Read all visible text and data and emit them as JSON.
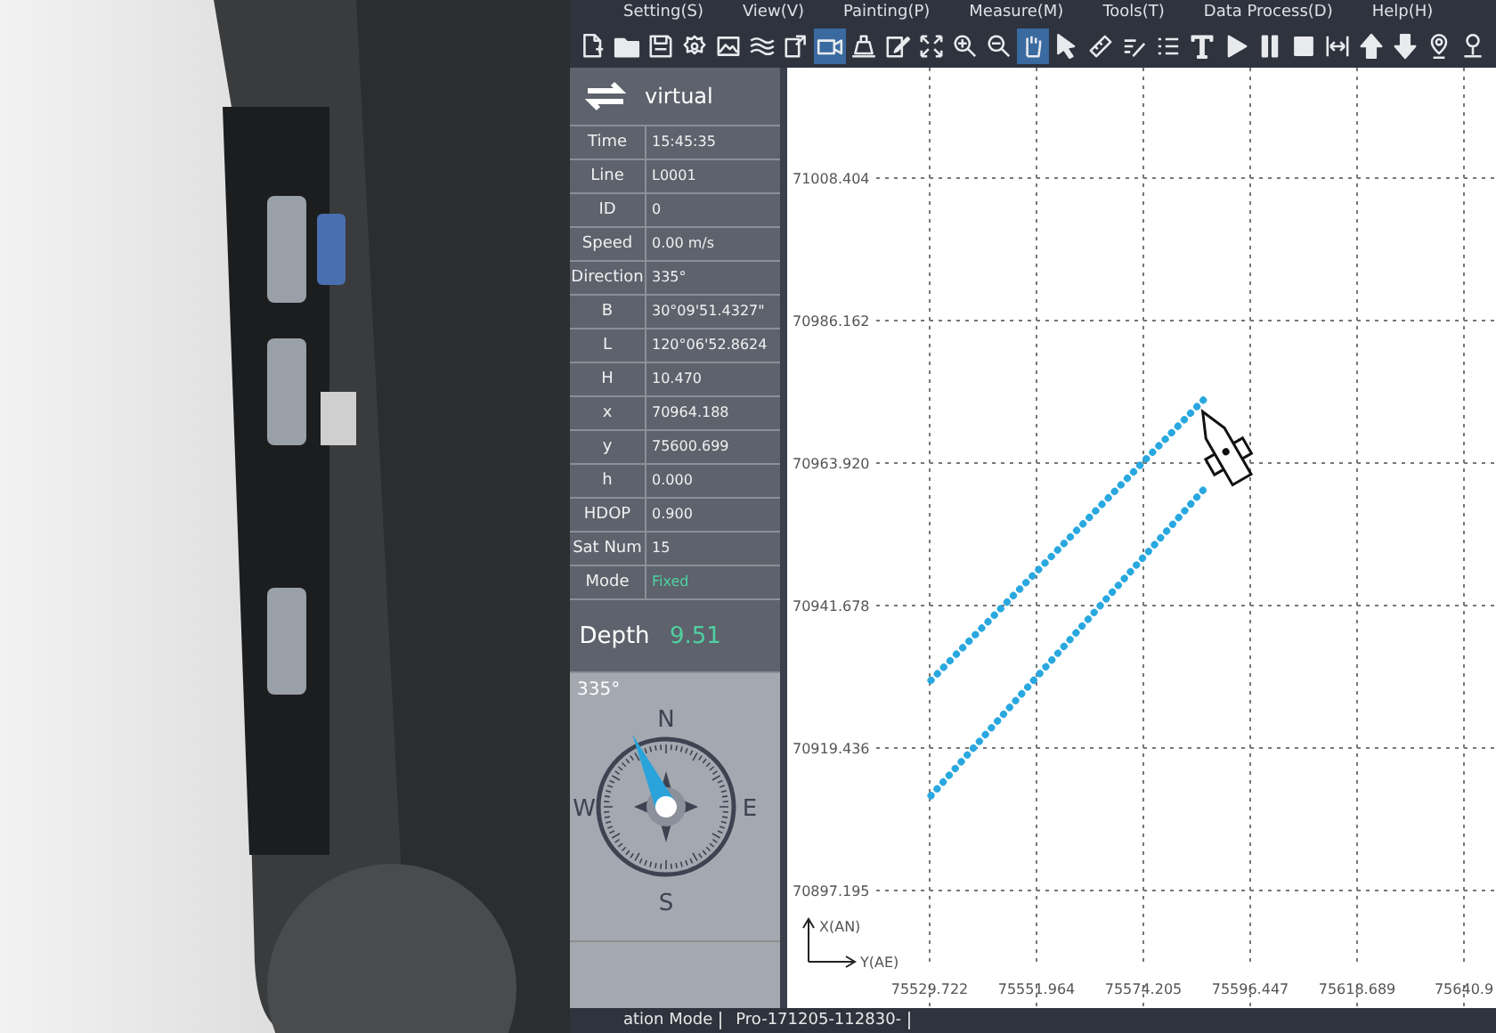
{
  "menu": [
    "Setting(S)",
    "View(V)",
    "Painting(P)",
    "Measure(M)",
    "Tools(T)",
    "Data Process(D)",
    "Help(H)"
  ],
  "toolbar": [
    {
      "kind": "new-file",
      "selected": false
    },
    {
      "kind": "folder",
      "selected": false
    },
    {
      "kind": "save",
      "selected": false
    },
    {
      "kind": "gear",
      "selected": false
    },
    {
      "kind": "image",
      "selected": false
    },
    {
      "kind": "waves",
      "selected": false
    },
    {
      "kind": "export",
      "selected": false
    },
    {
      "kind": "camera",
      "selected": true
    },
    {
      "kind": "beacon",
      "selected": false
    },
    {
      "kind": "edit",
      "selected": false
    },
    {
      "kind": "fit",
      "selected": false
    },
    {
      "kind": "zoom-in",
      "selected": false
    },
    {
      "kind": "zoom-out",
      "selected": false
    },
    {
      "kind": "hand",
      "selected": true
    },
    {
      "kind": "pointer",
      "selected": false
    },
    {
      "kind": "ruler",
      "selected": false
    },
    {
      "kind": "pen-lines",
      "selected": false
    },
    {
      "kind": "list",
      "selected": false
    },
    {
      "kind": "text",
      "selected": false
    },
    {
      "kind": "play",
      "selected": false
    },
    {
      "kind": "pause",
      "selected": false
    },
    {
      "kind": "stop",
      "selected": false
    },
    {
      "kind": "fit-width",
      "selected": false
    },
    {
      "kind": "arrow-up",
      "selected": false
    },
    {
      "kind": "arrow-down",
      "selected": false
    },
    {
      "kind": "pin",
      "selected": false
    },
    {
      "kind": "pin-base",
      "selected": false
    }
  ],
  "panel": {
    "source": "virtual",
    "rows": [
      {
        "label": "Time",
        "value": "15:45:35",
        "kind": "plain"
      },
      {
        "label": "Line",
        "value": "L0001",
        "kind": "plain"
      },
      {
        "label": "ID",
        "value": "0",
        "kind": "plain"
      },
      {
        "label": "Speed",
        "value": "0.00 m/s",
        "kind": "plain"
      },
      {
        "label": "Direction",
        "value": "335°",
        "kind": "plain"
      },
      {
        "label": "B",
        "value": "30°09'51.4327\"",
        "kind": "plain"
      },
      {
        "label": "L",
        "value": "120°06'52.8624",
        "kind": "plain"
      },
      {
        "label": "H",
        "value": "10.470",
        "kind": "plain"
      },
      {
        "label": "x",
        "value": "70964.188",
        "kind": "plain"
      },
      {
        "label": "y",
        "value": "75600.699",
        "kind": "plain"
      },
      {
        "label": "h",
        "value": "0.000",
        "kind": "plain"
      },
      {
        "label": "HDOP",
        "value": "0.900",
        "kind": "plain"
      },
      {
        "label": "Sat Num",
        "value": "15",
        "kind": "plain"
      },
      {
        "label": "Mode",
        "value": "Fixed",
        "kind": "status"
      }
    ],
    "depth": {
      "label": "Depth",
      "value": "9.51"
    },
    "compass": {
      "reading": "335°",
      "north": "N",
      "east": "E",
      "south": "S",
      "west": "W"
    }
  },
  "map": {
    "chart_data": {
      "type": "line",
      "xlabel": "Y(AE)",
      "ylabel": "X(AN)",
      "x": [
        75530,
        75587
      ],
      "series": [
        {
          "color": "#29a8e0",
          "line_style": "dotted",
          "values": [
            70930,
            70974
          ]
        },
        {
          "color": "#29a8e0",
          "line_style": "dotted",
          "values": [
            70912,
            70960
          ]
        }
      ],
      "grid": true,
      "xlim": [
        75529.722,
        75640.931
      ],
      "ylim": [
        70897.195,
        71008.404
      ],
      "xticks": [
        {
          "value": 75529.722,
          "label": "75529.722"
        },
        {
          "value": 75551.964,
          "label": "75551.964"
        },
        {
          "value": 75574.205,
          "label": "75574.205"
        },
        {
          "value": 75596.447,
          "label": "75596.447"
        },
        {
          "value": 75618.689,
          "label": "75618.689"
        },
        {
          "value": 75640.931,
          "label": "75640.9"
        }
      ],
      "yticks": [
        {
          "value": 71008.404,
          "label": "71008.404"
        },
        {
          "value": 70986.162,
          "label": "70986.162"
        },
        {
          "value": 70963.92,
          "label": "70963.920"
        },
        {
          "value": 70941.678,
          "label": "70941.678"
        },
        {
          "value": 70919.436,
          "label": "70919.436"
        },
        {
          "value": 70897.195,
          "label": "70897.195"
        }
      ]
    }
  },
  "status_bar": [
    "ation Mode",
    "Pro-171205-112830-"
  ]
}
